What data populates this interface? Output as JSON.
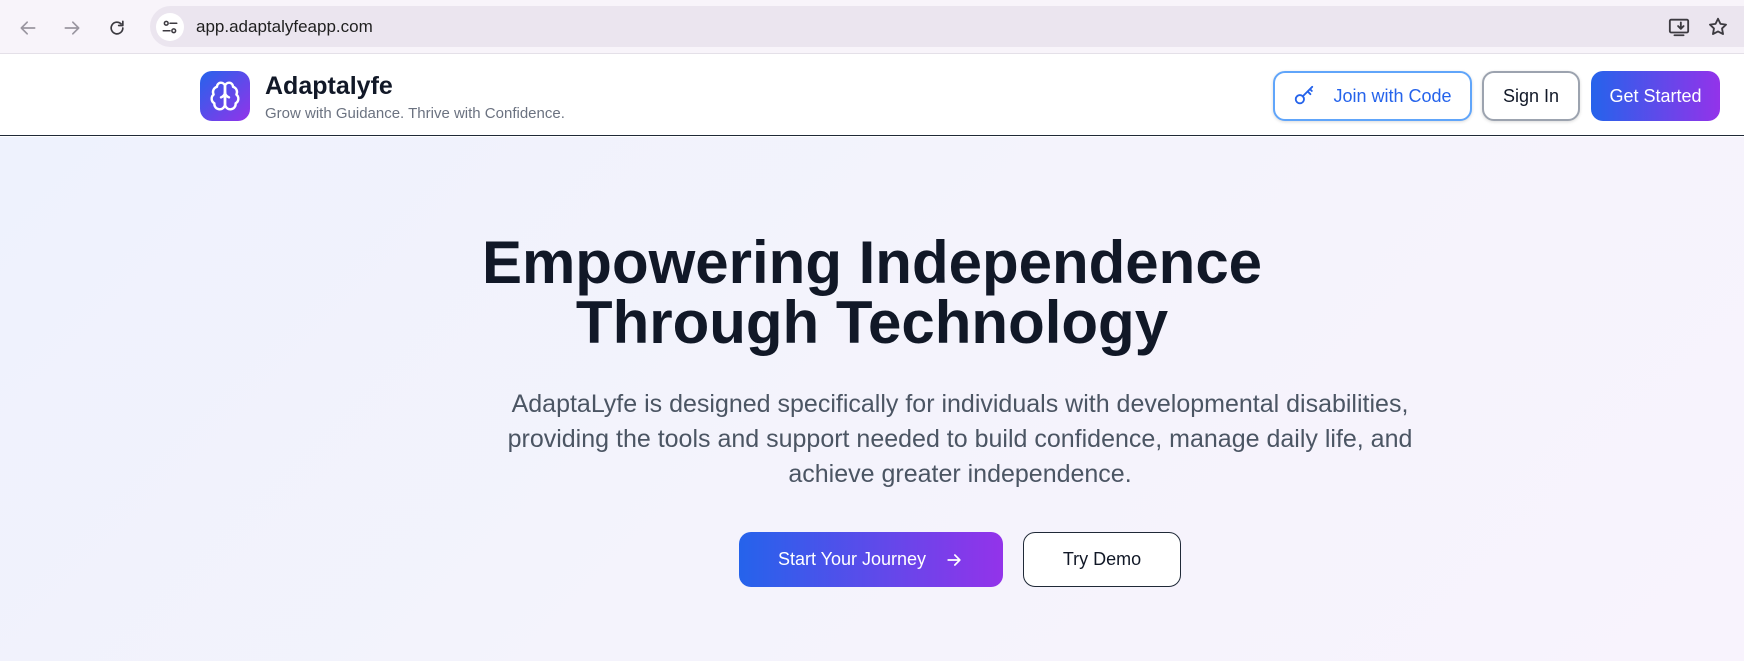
{
  "browser": {
    "url": "app.adaptalyfeapp.com",
    "icons": [
      "back-arrow-icon",
      "forward-arrow-icon",
      "reload-icon",
      "site-settings-icon",
      "install-app-icon",
      "bookmark-star-icon"
    ]
  },
  "header": {
    "brand_name": "Adaptalyfe",
    "tagline": "Grow with Guidance. Thrive with Confidence.",
    "logo_icon": "brain-icon",
    "join_label": "Join with Code",
    "join_icon": "key-icon",
    "signin_label": "Sign In",
    "get_started_label": "Get Started"
  },
  "hero": {
    "title_line1": "Empowering Independence",
    "title_line2": "Through Technology",
    "description": "AdaptaLyfe is designed specifically for individuals with developmental disabilities, providing the tools and support needed to build confidence, manage daily life, and achieve greater independence.",
    "primary_cta": "Start Your Journey",
    "primary_cta_icon": "arrow-right-icon",
    "secondary_cta": "Try Demo"
  },
  "colors": {
    "accent_start": "#2563eb",
    "accent_end": "#9333ea",
    "heading": "#111827",
    "body_text": "#4b5563"
  }
}
